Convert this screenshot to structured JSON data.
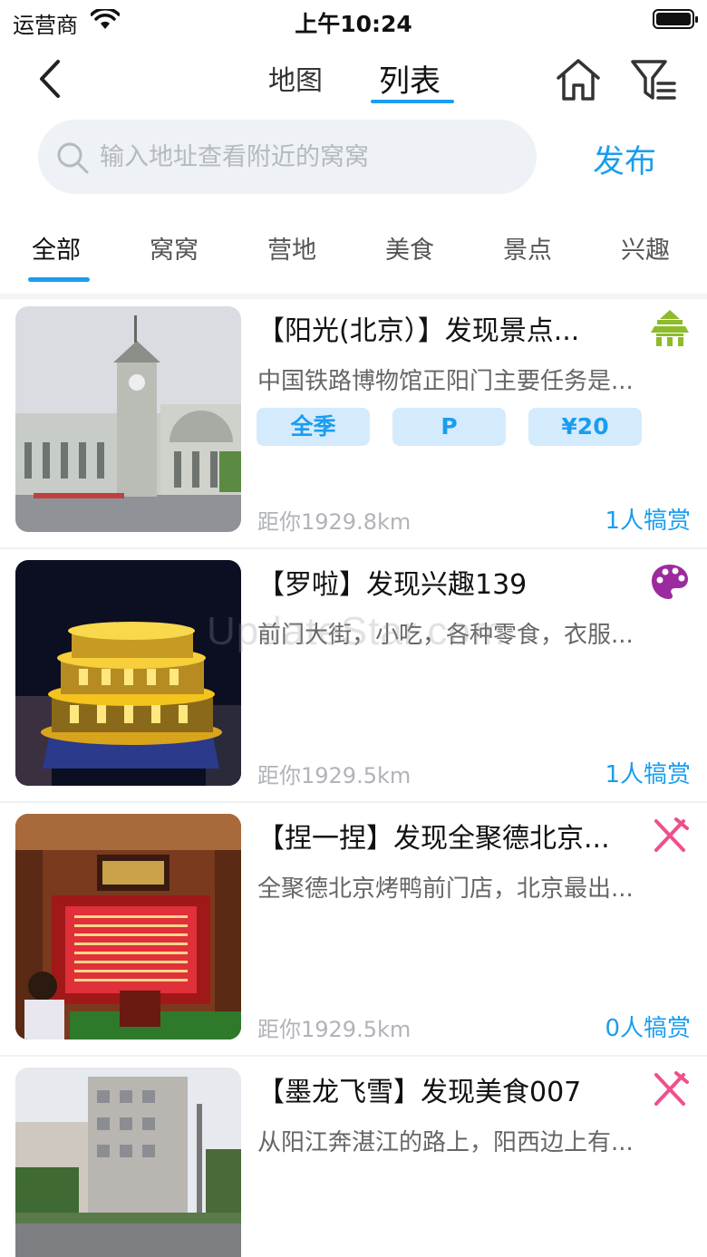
{
  "status_bar": {
    "carrier": "运营商",
    "time": "上午10:24"
  },
  "nav": {
    "tab_map": "地图",
    "tab_list": "列表"
  },
  "search": {
    "placeholder": "输入地址查看附近的窝窝",
    "publish_label": "发布"
  },
  "categories": [
    "全部",
    "窝窝",
    "营地",
    "美食",
    "景点",
    "兴趣"
  ],
  "items": [
    {
      "title": "【阳光(北京）】发现景点...",
      "description": "中国铁路博物馆正阳门主要任务是...",
      "tags": [
        "全季",
        "P",
        "¥20"
      ],
      "distance": "距你1929.8km",
      "reward": "1人犒赏",
      "icon": "landmark-icon",
      "icon_color": "#8dbb2c"
    },
    {
      "title": "【罗啦】发现兴趣139",
      "description": "前门大街，小吃，各种零食，衣服...",
      "tags": [],
      "distance": "距你1929.5km",
      "reward": "1人犒赏",
      "icon": "palette-icon",
      "icon_color": "#9b2b9e"
    },
    {
      "title": "【捏一捏】发现全聚德北京...",
      "description": "全聚德北京烤鸭前门店，北京最出...",
      "tags": [],
      "distance": "距你1929.5km",
      "reward": "0人犒赏",
      "icon": "fork-knife-icon",
      "icon_color": "#ef4f8d"
    },
    {
      "title": "【墨龙飞雪】发现美食007",
      "description": "从阳江奔湛江的路上，阳西边上有...",
      "tags": [],
      "distance": "",
      "reward": "",
      "icon": "fork-knife-icon",
      "icon_color": "#ef4f8d"
    }
  ],
  "watermark": "UpdateStar.com",
  "colors": {
    "accent": "#1a9df0",
    "tag_bg": "#d4ebfd"
  }
}
